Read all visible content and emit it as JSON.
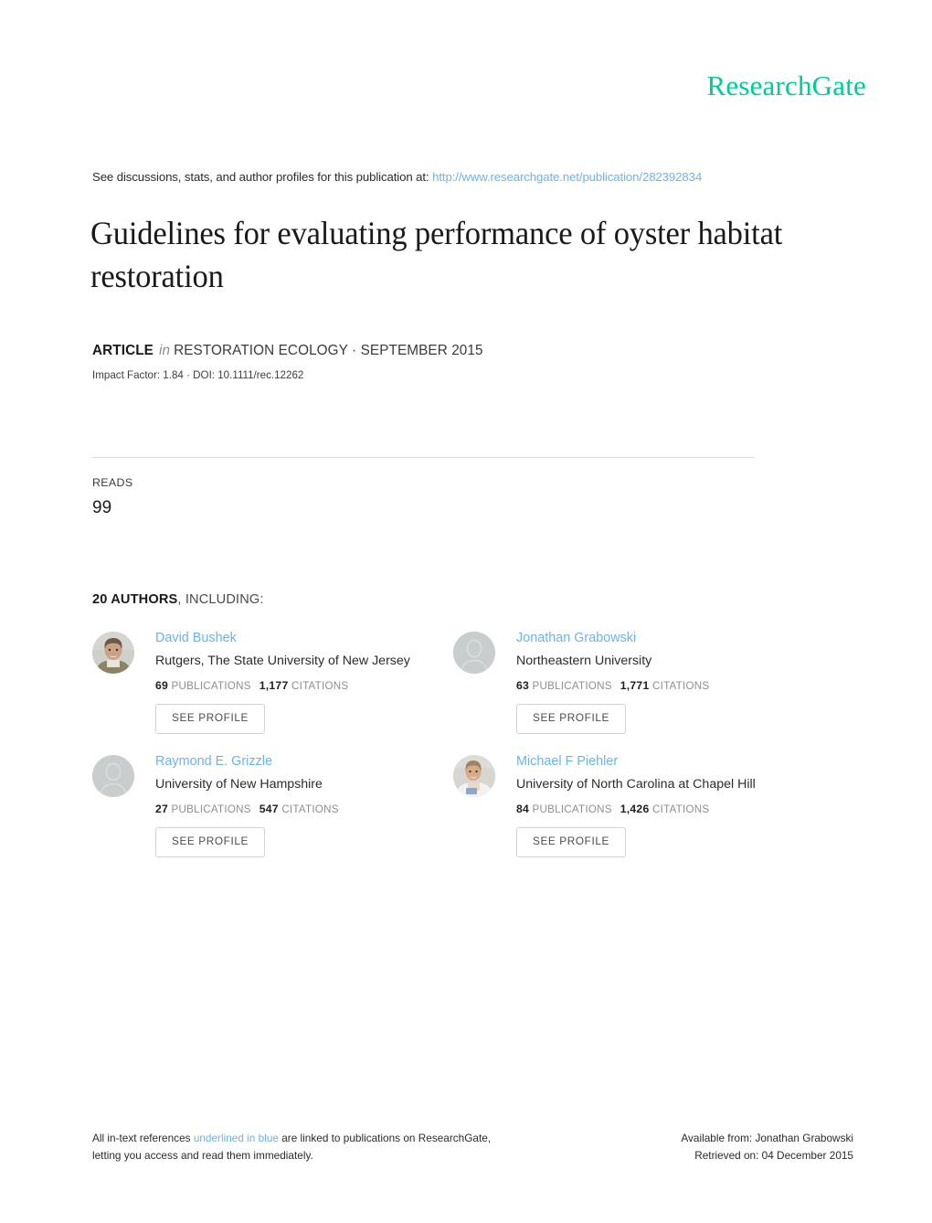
{
  "brand": {
    "name": "ResearchGate",
    "color": "#00cc99"
  },
  "intro": {
    "text": "See discussions, stats, and author profiles for this publication at:",
    "url": "http://www.researchgate.net/publication/282392834"
  },
  "publication": {
    "title": "Guidelines for evaluating performance of oyster habitat restoration",
    "type_label": "ARTICLE",
    "in_word": "in",
    "journal_line": "RESTORATION ECOLOGY · SEPTEMBER 2015",
    "impact_line": "Impact Factor: 1.84 · DOI: 10.1111/rec.12262"
  },
  "metrics": {
    "reads_label": "READS",
    "reads_value": "99"
  },
  "authors_section": {
    "count_label": "20 AUTHORS",
    "including_label": ", INCLUDING:",
    "publications_label": "PUBLICATIONS",
    "citations_label": "CITATIONS",
    "see_profile_label": "SEE PROFILE",
    "name_color": "#6cb3ec",
    "authors": [
      {
        "name": "David Bushek",
        "affiliation": "Rutgers, The State University of New Jersey",
        "publications": "69",
        "citations": "1,177",
        "avatar": "photo-avatar-bushek"
      },
      {
        "name": "Jonathan Grabowski",
        "affiliation": "Northeastern University",
        "publications": "63",
        "citations": "1,771",
        "avatar": "placeholder-avatar"
      },
      {
        "name": "Raymond E. Grizzle",
        "affiliation": "University of New Hampshire",
        "publications": "27",
        "citations": "547",
        "avatar": "placeholder-avatar"
      },
      {
        "name": "Michael F Piehler",
        "affiliation": "University of North Carolina at Chapel Hill",
        "publications": "84",
        "citations": "1,426",
        "avatar": "photo-avatar-piehler"
      }
    ]
  },
  "footer": {
    "left_part1": "All in-text references ",
    "left_link": "underlined in blue",
    "left_part2": " are linked to publications on ResearchGate,",
    "left_line2": "letting you access and read them immediately.",
    "right_line1": "Available from: Jonathan Grabowski",
    "right_line2": "Retrieved on: 04 December 2015"
  }
}
